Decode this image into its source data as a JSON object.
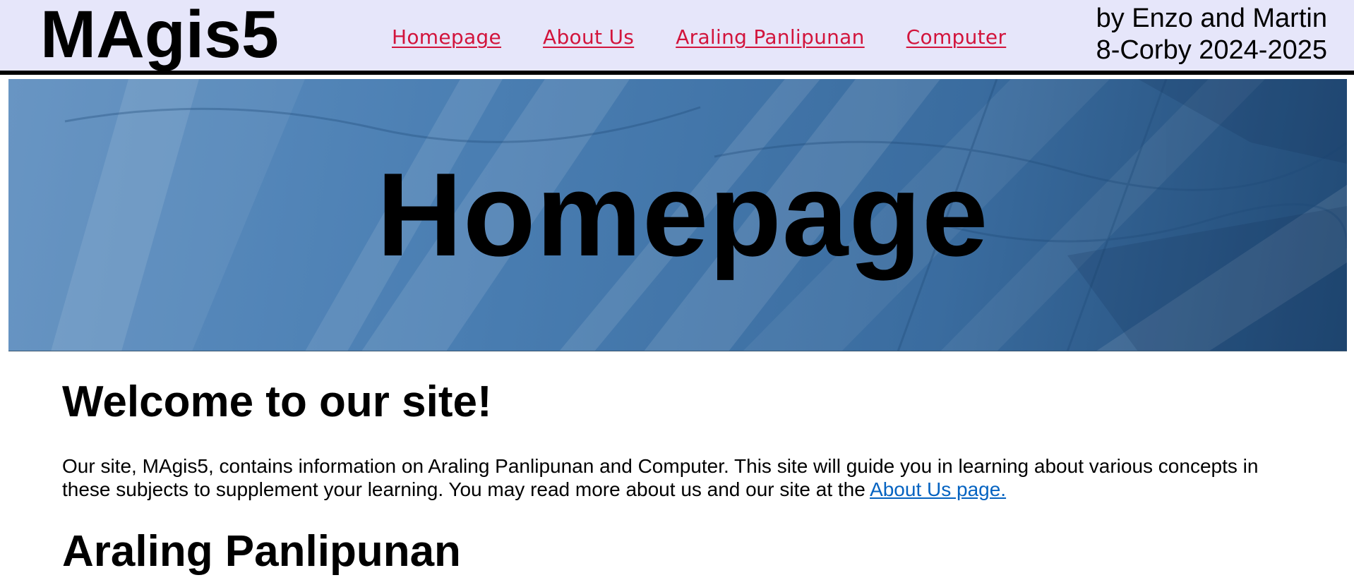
{
  "header": {
    "logo": "MAgis5",
    "nav": [
      {
        "label": "Homepage"
      },
      {
        "label": "About Us"
      },
      {
        "label": "Araling Panlipunan"
      },
      {
        "label": "Computer"
      }
    ],
    "byline_line1": "by Enzo and Martin",
    "byline_line2": "8-Corby 2024-2025",
    "background_color": "#e6e6fa",
    "link_color": "#d2143c"
  },
  "hero": {
    "title": "Homepage"
  },
  "main": {
    "welcome_heading": "Welcome to our site!",
    "intro_text": "Our site, MAgis5, contains information on Araling Panlipunan and Computer. This site will guide you in learning about various concepts in these subjects to supplement your learning. You may read more about us and our site at the ",
    "intro_link": "About Us page.",
    "section_heading": "Araling Panlipunan",
    "link_color": "#0563c1"
  }
}
